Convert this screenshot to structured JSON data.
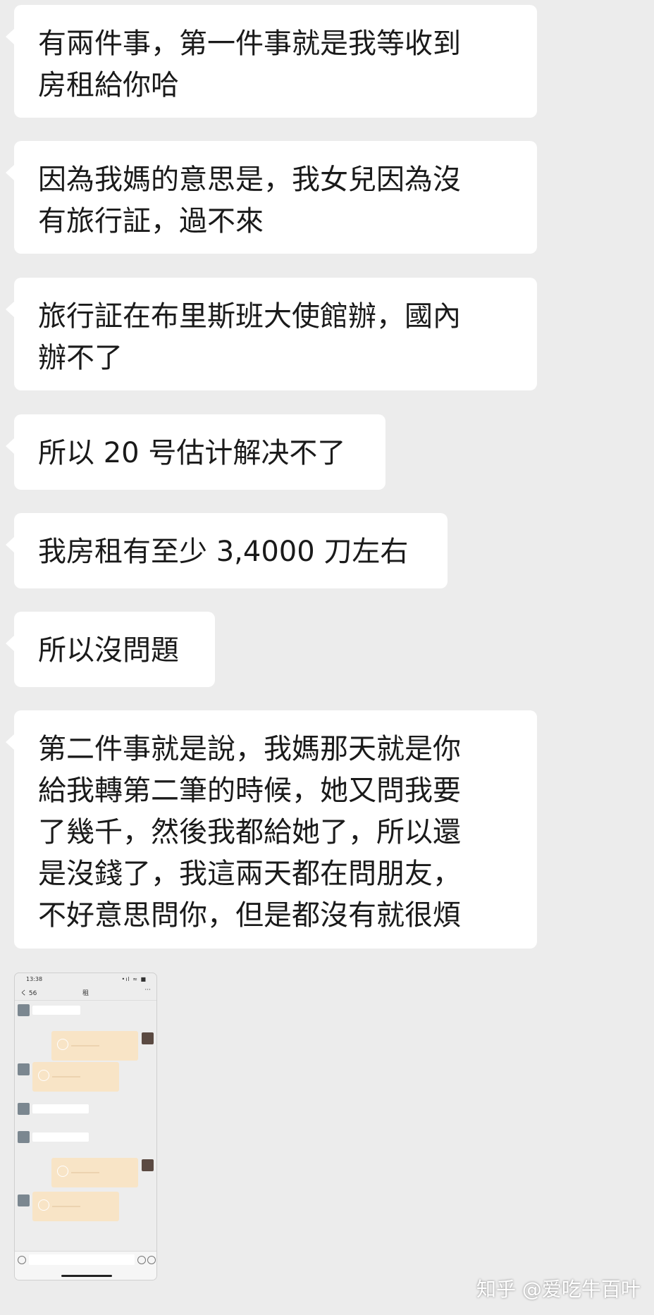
{
  "messages": [
    {
      "lines": [
        "有兩件事，第一件事就是我等收到",
        "房租給你哈"
      ]
    },
    {
      "lines": [
        "因為我媽的意思是，我女兒因為沒",
        "有旅行証，過不來"
      ]
    },
    {
      "lines": [
        "旅行証在布里斯班大使館辦，國內",
        "辦不了"
      ]
    },
    {
      "lines": [
        "所以 20 号估计解决不了"
      ]
    },
    {
      "lines": [
        "我房租有至少 3,4000 刀左右"
      ]
    },
    {
      "lines": [
        "所以沒問題"
      ]
    },
    {
      "lines": [
        "第二件事就是說，我媽那天就是你",
        "給我轉第二筆的時候，她又問我要",
        "了幾千，然後我都給她了，所以還",
        "是沒錢了，我這兩天都在問朋友，",
        "不好意思問你，但是都沒有就很煩"
      ]
    }
  ],
  "embedded_screenshot": {
    "status_time": "13:38",
    "status_icons": "•ıl ≈ ■",
    "back_label": "く 56",
    "title": "租",
    "more": "···"
  },
  "watermark": "知乎 @爱吃牛百叶"
}
